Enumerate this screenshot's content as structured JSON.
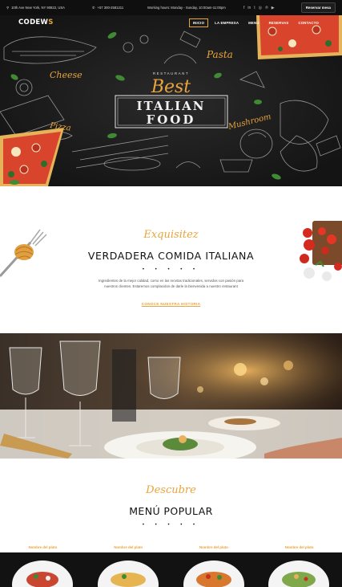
{
  "topbar": {
    "address": "10th Ave New York, NY 90822, USA",
    "phone": "+57 300-2581211",
    "hours": "Working hours: Monday - Sunday, 10:00am-11:00pm",
    "socials": [
      "facebook-icon",
      "linkedin-icon",
      "twitter-icon",
      "instagram-icon",
      "pinterest-icon",
      "youtube-icon"
    ],
    "reserve_label": "Reservar mesa"
  },
  "nav": {
    "logo_main": "CODEW",
    "logo_accent": "S",
    "items": [
      {
        "label": "INICIO",
        "active": true
      },
      {
        "label": "LA EMPRESA",
        "active": false
      },
      {
        "label": "MENÚ",
        "active": false
      },
      {
        "label": "RESERVAS",
        "active": false
      },
      {
        "label": "CONTACTO",
        "active": false
      }
    ]
  },
  "hero": {
    "restaurant": "RESTAURANT",
    "best": "Best",
    "line1": "ITALIAN",
    "line2": "FOOD",
    "pasta": "Pasta",
    "cheese": "Cheese",
    "pizza": "Pizza",
    "mushroom": "Mushroom"
  },
  "intro": {
    "script": "Exquisitez",
    "title": "VERDADERA COMIDA ITALIANA",
    "body": "Ingredientes de la mejor calidad, como en las recetas tradicionales, servidos con pasión para nuestros clientes. Estaremos complacidos de darle la bienvenida a nuestro restaurant",
    "link": "CONOCE NUESTRA HISTORIA"
  },
  "popular": {
    "script": "Descubre",
    "title": "MENÚ POPULAR",
    "dish_label": "Nombre del plato",
    "cards": [
      "Nombre del plato",
      "Nombre del plato",
      "Nombre del plato",
      "Nombre del plato"
    ]
  },
  "colors": {
    "accent": "#e9a43c",
    "dark": "#0f0f0f"
  },
  "dots": "• • • • •"
}
